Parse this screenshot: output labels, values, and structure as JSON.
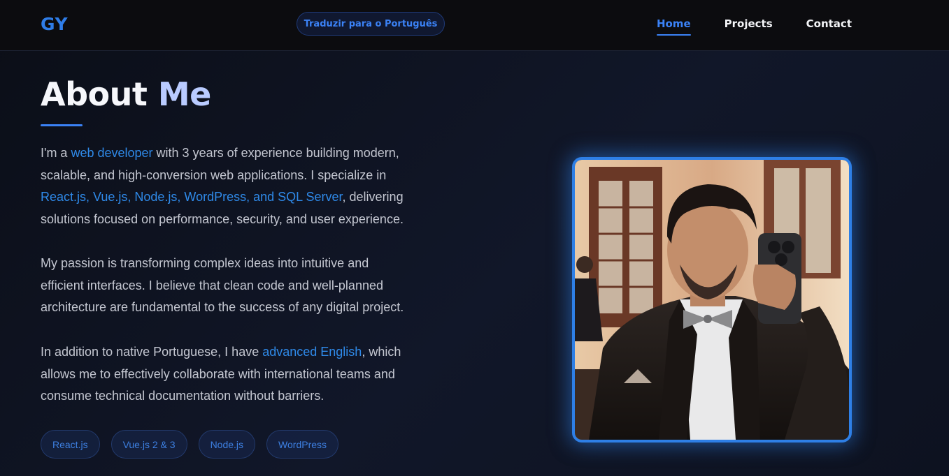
{
  "nav": {
    "logo": "GY",
    "translate_label": "Traduzir para o Português",
    "links": [
      {
        "label": "Home",
        "active": true
      },
      {
        "label": "Projects",
        "active": false
      },
      {
        "label": "Contact",
        "active": false
      }
    ]
  },
  "about": {
    "title_part1": "About",
    "title_part2": "Me",
    "p1": {
      "t1": "I'm a ",
      "h1": "web developer",
      "t2": " with 3 years of experience building modern, scalable, and high-conversion web applications. I specialize in ",
      "h2": "React.js, Vue.js, Node.js, WordPress, and SQL Server",
      "t3": ", delivering solutions focused on performance, security, and user experience."
    },
    "p2": "My passion is transforming complex ideas into intuitive and efficient interfaces. I believe that clean code and well-planned architecture are fundamental to the success of any digital project.",
    "p3": {
      "t1": "In addition to native Portuguese, I have ",
      "h1": "advanced English",
      "t2": ", which allows me to effectively collaborate with international teams and consume technical documentation without barriers."
    },
    "tags": [
      "React.js",
      "Vue.js 2 & 3",
      "Node.js",
      "WordPress"
    ]
  },
  "colors": {
    "accent": "#3b82f6",
    "highlight": "#2f8ae9",
    "background": "#0f1424",
    "navbar": "#0c0c0f"
  }
}
